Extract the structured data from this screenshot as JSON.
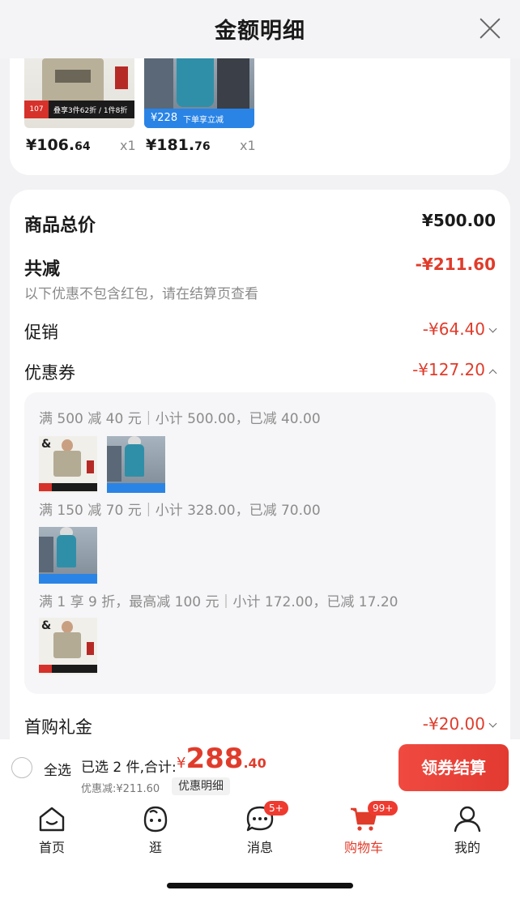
{
  "header": {
    "title": "金额明细",
    "close_icon": "close-icon"
  },
  "products": [
    {
      "price_main": "¥106.",
      "price_cents": "64",
      "qty": "x1",
      "promo_tag": "107",
      "promo_text": "叠享3件62折 / 1件8折"
    },
    {
      "price_main": "¥181.",
      "price_cents": "76",
      "qty": "x1",
      "promo_tag": "¥228",
      "promo_text": "下单享立减"
    }
  ],
  "summary": {
    "total_label": "商品总价",
    "total_value": "¥500.00",
    "reduce_label": "共减",
    "reduce_value": "-¥211.60",
    "reduce_note": "以下优惠不包含红包，请在结算页查看",
    "promo_label": "促销",
    "promo_value": "-¥64.40",
    "coupon_label": "优惠券",
    "coupon_value": "-¥127.20",
    "first_label": "首购礼金",
    "first_value": "-¥20.00"
  },
  "coupons": [
    {
      "line": "满 500 减 40 元｜小计 500.00，已减 40.00"
    },
    {
      "line": "满 150 减 70 元｜小计 328.00，已减 70.00"
    },
    {
      "line": "满 1 享 9 折，最高减 100 元｜小计 172.00，已减 17.20"
    }
  ],
  "checkout": {
    "select_all": "全选",
    "picked": "已选 2 件,合计:",
    "yen": "¥",
    "total_int": "288",
    "total_dec": ".40",
    "discount": "优惠减:¥211.60",
    "detail_btn": "优惠明细",
    "button": "领券结算"
  },
  "tabs": [
    {
      "label": "首页",
      "icon": "home-icon"
    },
    {
      "label": "逛",
      "icon": "browse-icon"
    },
    {
      "label": "消息",
      "icon": "message-icon",
      "badge": "5+"
    },
    {
      "label": "购物车",
      "icon": "cart-icon",
      "badge": "99+",
      "active": true
    },
    {
      "label": "我的",
      "icon": "profile-icon"
    }
  ],
  "colors": {
    "accent": "#e03c2b",
    "button": "#ef4a40",
    "background": "#f2f2f4"
  }
}
